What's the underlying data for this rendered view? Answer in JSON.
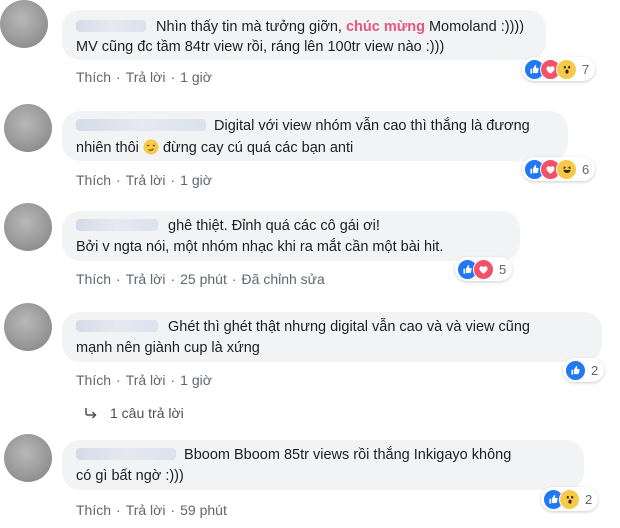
{
  "actions": {
    "like": "Thích",
    "reply": "Trả lời",
    "edit": "Đã chỉnh sửa"
  },
  "comments": [
    {
      "text_before": "Nhìn thấy tin mà tưởng giỡn, ",
      "text_highlight": "chúc mừng",
      "text_after": " Momoland :))))",
      "line2": "MV cũng đc tầm 84tr view rồi, ráng lên 100tr view nào :)))",
      "time": "1 giờ",
      "reactions": [
        "like",
        "love",
        "wow"
      ],
      "reaction_count": "7"
    },
    {
      "line1": "Digital với view nhóm vẫn cao thì thắng là đương",
      "line2a": "nhiên thôi ",
      "emoji": "smirk-emoji",
      "line2b": " đừng cay cú quá các bạn anti",
      "time": "1 giờ",
      "reactions": [
        "like",
        "love",
        "haha"
      ],
      "reaction_count": "6"
    },
    {
      "line1": "ghê thiệt. Đỉnh quá các cô gái ơi!",
      "line2": "Bởi v ngta nói, một nhóm nhạc khi ra mắt cần một bài hit.",
      "time": "25 phút",
      "reactions": [
        "like",
        "love"
      ],
      "reaction_count": "5",
      "edited": true
    },
    {
      "line1": "Ghét thì ghét thật nhưng digital vẫn cao và và view cũng",
      "line2": "mạnh nên giành cup là xứng",
      "time": "1 giờ",
      "reactions": [
        "like"
      ],
      "reaction_count": "2",
      "replies_label": "1 câu trả lời"
    },
    {
      "line1": "Bboom Bboom 85tr views rồi thắng Inkigayo không",
      "line2": "có gì bất ngờ :)))",
      "time": "59 phút",
      "reactions": [
        "like",
        "wow"
      ],
      "reaction_count": "2"
    }
  ],
  "colors": {
    "highlight": "#e5577c",
    "like": "#2078f4",
    "love": "#f25268",
    "wow": "#f7c948"
  }
}
